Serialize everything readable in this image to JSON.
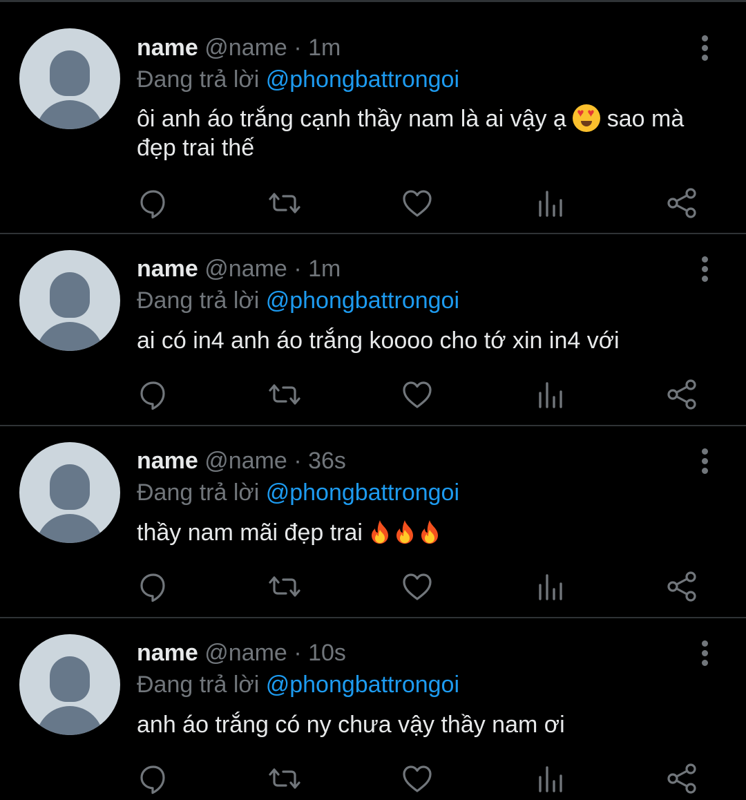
{
  "colors": {
    "background": "#000000",
    "divider": "#2f3336",
    "text": "#e7e9ea",
    "secondary": "#71767b",
    "mention": "#1d9bf0"
  },
  "replies": [
    {
      "name": "name",
      "handle": "@name",
      "separator": "·",
      "time": "1m",
      "reply_prefix": "Đang trả lời",
      "reply_to": "@phongbattrongoi",
      "text_before_emoji": "ôi anh áo trắng cạnh thầy nam là ai vậy ạ",
      "emoji": "smiling-face-heart-eyes",
      "text_after_emoji": "sao mà đẹp trai thế"
    },
    {
      "name": "name",
      "handle": "@name",
      "separator": "·",
      "time": "1m",
      "reply_prefix": "Đang trả lời",
      "reply_to": "@phongbattrongoi",
      "text": "ai có in4 anh áo trắng koooo cho tớ xin in4 với"
    },
    {
      "name": "name",
      "handle": "@name",
      "separator": "·",
      "time": "36s",
      "reply_prefix": "Đang trả lời",
      "reply_to": "@phongbattrongoi",
      "text": "thầy nam mãi đẹp trai",
      "emoji": "fire",
      "emoji_count": 3
    },
    {
      "name": "name",
      "handle": "@name",
      "separator": "·",
      "time": "10s",
      "reply_prefix": "Đang trả lời",
      "reply_to": "@phongbattrongoi",
      "text": "anh áo trắng có ny chưa vậy thầy nam ơi"
    }
  ],
  "action_icons": [
    "reply-icon",
    "retweet-icon",
    "like-icon",
    "views-icon",
    "share-icon"
  ],
  "menu_icon": "more-options-icon"
}
